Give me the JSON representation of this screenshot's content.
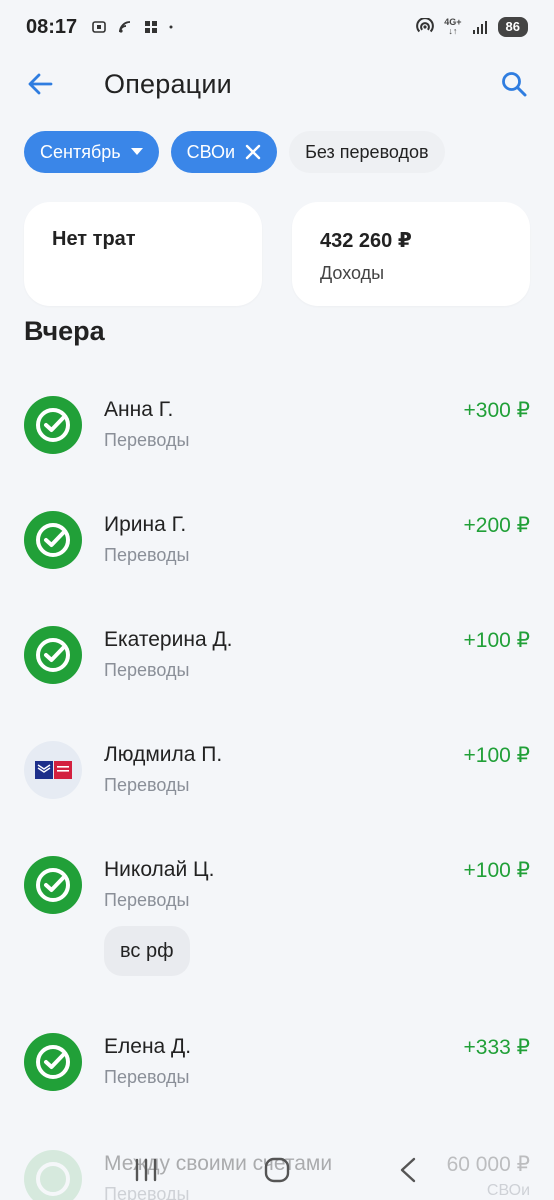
{
  "status_bar": {
    "time": "08:17",
    "battery": "86",
    "network": "4G+"
  },
  "header": {
    "title": "Операции",
    "back_icon": "arrow-left-icon",
    "search_icon": "search-icon"
  },
  "filters": [
    {
      "label": "Сентябрь",
      "active": true,
      "icon": "caret-down-icon"
    },
    {
      "label": "СВОи",
      "active": true,
      "icon": "close-icon"
    },
    {
      "label": "Без переводов",
      "active": false
    }
  ],
  "summary": {
    "expenses": {
      "title": "Нет трат"
    },
    "income": {
      "amount": "432 260 ₽",
      "label": "Доходы"
    }
  },
  "section": {
    "title": "Вчера"
  },
  "transactions": [
    {
      "name": "Анна Г.",
      "category": "Переводы",
      "amount": "+300 ₽",
      "bank": "sber"
    },
    {
      "name": "Ирина Г.",
      "category": "Переводы",
      "amount": "+200 ₽",
      "bank": "sber"
    },
    {
      "name": "Екатерина Д.",
      "category": "Переводы",
      "amount": "+100 ₽",
      "bank": "sber"
    },
    {
      "name": "Людмила П.",
      "category": "Переводы",
      "amount": "+100 ₽",
      "bank": "pochta"
    },
    {
      "name": "Николай Ц.",
      "category": "Переводы",
      "amount": "+100 ₽",
      "bank": "sber",
      "comment": "вс рф"
    },
    {
      "name": "Елена Д.",
      "category": "Переводы",
      "amount": "+333 ₽",
      "bank": "sber"
    },
    {
      "name": "Между своими счетами",
      "category": "Переводы",
      "amount": "60 000 ₽",
      "bank": "sber",
      "extra": "СВОи"
    }
  ],
  "colors": {
    "accent": "#3a86e8",
    "income_green": "#21a038",
    "background": "#f4f6f9"
  }
}
